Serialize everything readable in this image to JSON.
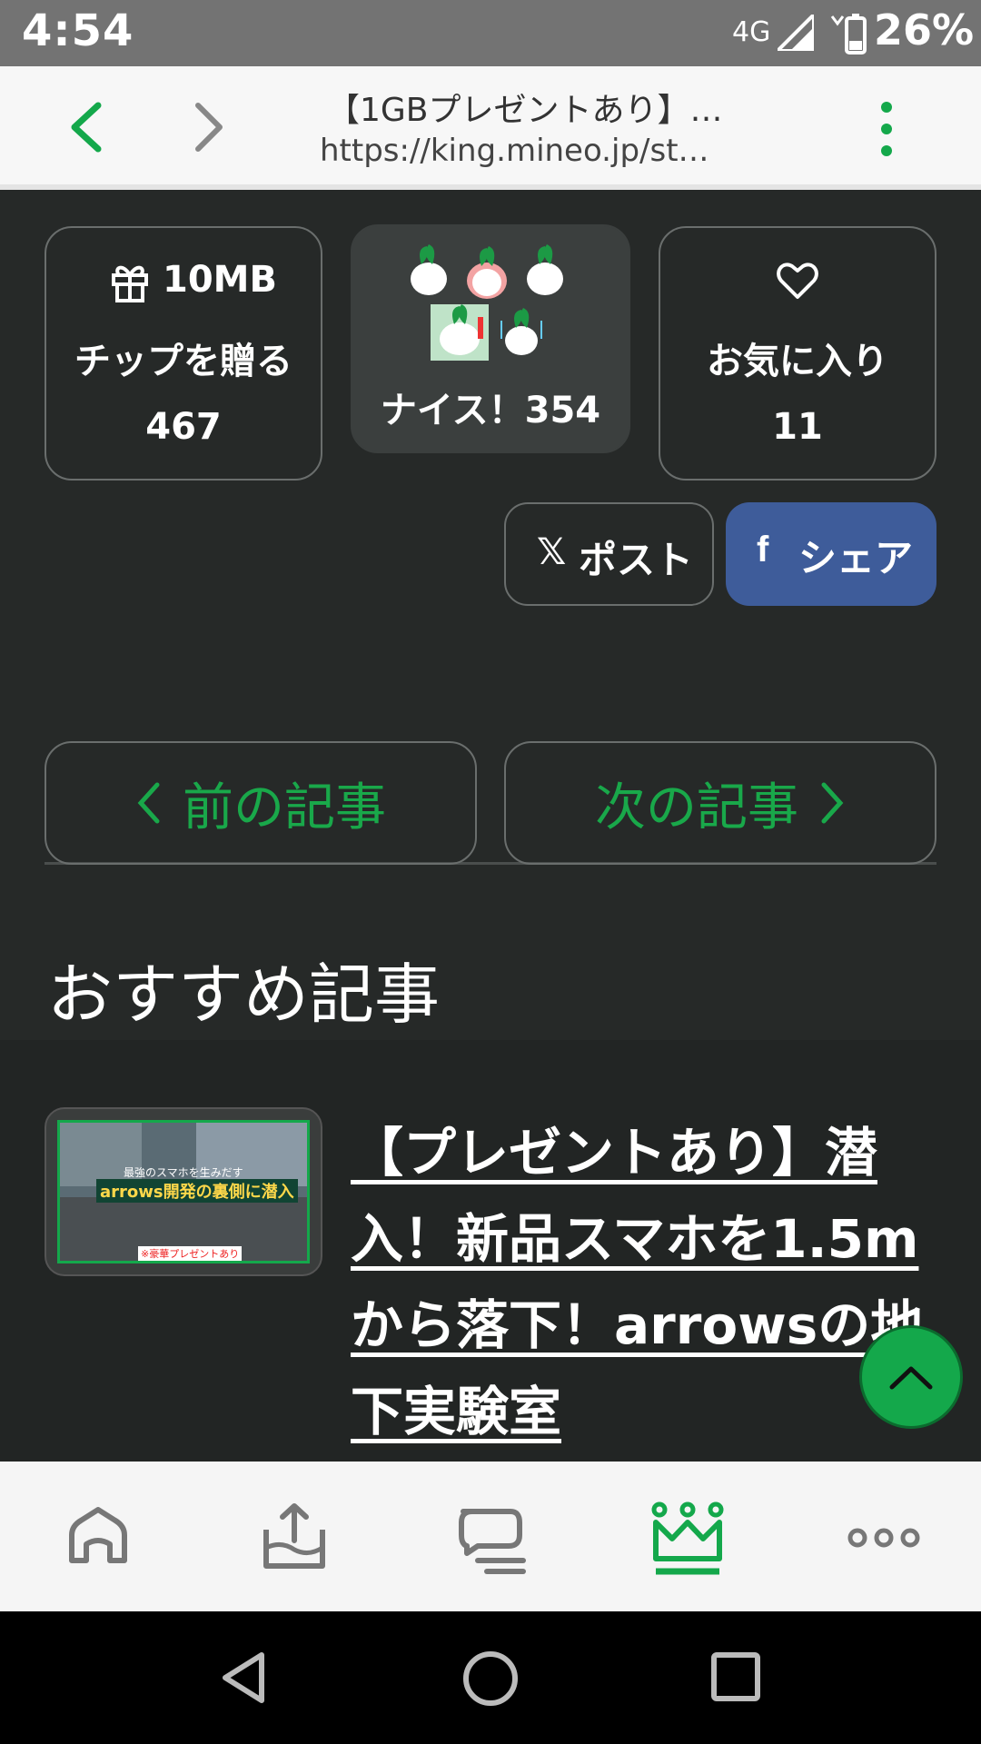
{
  "status_bar": {
    "time": "4:54",
    "network": "4G",
    "battery": "26%"
  },
  "browser": {
    "title": "【1GBプレゼントあり】…",
    "url": "https://king.mineo.jp/st…"
  },
  "reactions": {
    "tip": {
      "label": "10MB",
      "sub": "チップを贈る",
      "count": "467"
    },
    "nice": {
      "label": "ナイス！354"
    },
    "favorite": {
      "label": "お気に入り",
      "count": "11"
    }
  },
  "share": {
    "post_label": "ポスト",
    "share_label": "シェア"
  },
  "article_nav": {
    "prev": "前の記事",
    "next": "次の記事"
  },
  "recommended": {
    "heading": "おすすめ記事",
    "article_title": "【プレゼントあり】潜入！新品スマホを1.5mから落下！arrowsの地下実験室",
    "thumb_caption": "arrows開発の裏側に潜入",
    "thumb_small": "最強のスマホを生みだす",
    "thumb_badge": "※豪華プレゼントあり"
  },
  "tabbar": [
    "home-icon",
    "upload-icon",
    "chat-icon",
    "crown-icon",
    "more-icon"
  ],
  "colors": {
    "accent": "#14a84b",
    "facebook": "#3b5998",
    "page_bg": "#262928"
  }
}
